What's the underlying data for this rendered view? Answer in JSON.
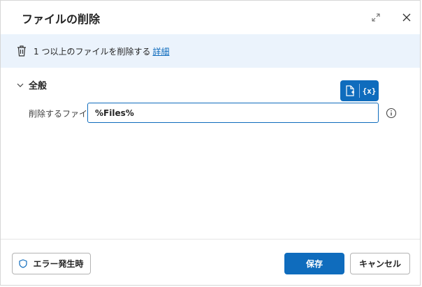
{
  "dialog": {
    "title": "ファイルの削除"
  },
  "info_bar": {
    "description": "1 つ以上のファイルを削除する",
    "link": "詳細"
  },
  "section": {
    "label": "全般"
  },
  "form": {
    "files_label": "削除するファイル:",
    "files_value": "%Files%",
    "variable_button": "{x}"
  },
  "footer": {
    "on_error_label": "エラー発生時",
    "save_label": "保存",
    "cancel_label": "キャンセル"
  },
  "colors": {
    "accent": "#0f6cbd",
    "info_bg": "#ebf3fc"
  }
}
